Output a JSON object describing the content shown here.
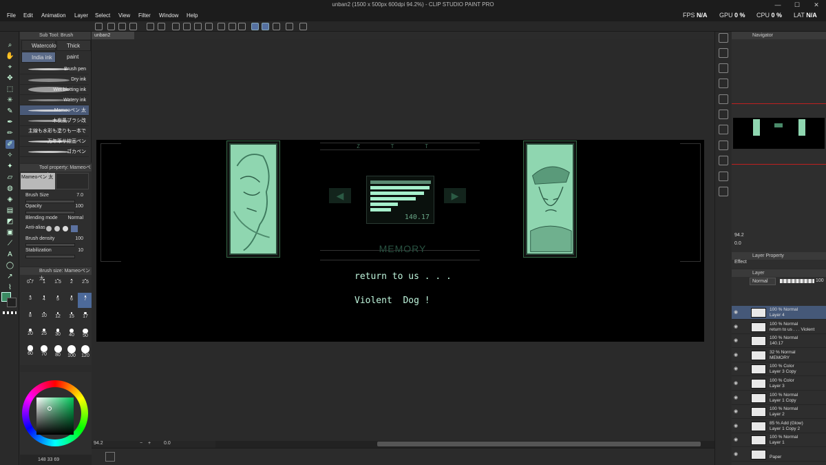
{
  "window": {
    "title": "unban2 (1500 x 500px 600dpi 94.2%) - CLIP STUDIO PAINT PRO",
    "controls": [
      "—",
      "☐",
      "✕"
    ]
  },
  "menu": [
    "File",
    "Edit",
    "Animation",
    "Layer",
    "Select",
    "View",
    "Filter",
    "Window",
    "Help"
  ],
  "perf": {
    "fps_label": "FPS",
    "fps": "N/A",
    "gpu_label": "GPU",
    "gpu": "0 %",
    "cpu_label": "CPU",
    "cpu": "0 %",
    "lat_label": "LAT",
    "lat": "N/A"
  },
  "subtool": {
    "header": "Sub Tool: Brush",
    "tabs": [
      "Watercolor",
      "Thick paint",
      "India ink"
    ],
    "brushes": [
      "Brush pen",
      "Dry ink",
      "Wet blotting ink",
      "Watery ink",
      "Mameoペン 太",
      "木炭風ブラシ改",
      "主線も水彩も塗りも一本で",
      "万年筆サ線画ペン",
      "ゴカペン"
    ]
  },
  "toolprop": {
    "header": "Tool property: Mameoペン 太",
    "preview_name": "Mameoペン 太",
    "brush_size_label": "Brush Size",
    "brush_size": "7.0",
    "opacity_label": "Opacity",
    "opacity": "100",
    "blend_label": "Blending mode",
    "blend": "Normal",
    "antialias_label": "Anti-alias",
    "density_label": "Brush density",
    "density": "100",
    "stabilization_label": "Stabilization",
    "stabilization": "10"
  },
  "brushsize": {
    "header": "Brush size: Mameoペン 太",
    "sizes": [
      "0.7",
      "1",
      "1.5",
      "2",
      "2.5",
      "3",
      "4",
      "5",
      "6",
      "7",
      "8",
      "10",
      "12",
      "15",
      "17",
      "20",
      "25",
      "30",
      "40",
      "50",
      "60",
      "70",
      "80",
      "100",
      "120"
    ]
  },
  "status": {
    "left": "148 33 69"
  },
  "canvas": {
    "tab": "unban2",
    "zoom": "94.2",
    "rotation": "0.0"
  },
  "artwork": {
    "header": "Z T T",
    "meter_value": "140.17",
    "label": "MEMORY",
    "line1": "return to us . . .",
    "line2": "Violent  Dog !"
  },
  "navigator": {
    "header": "Navigator",
    "zoom": "94.2",
    "rotation": "0.0"
  },
  "layerprop": {
    "header": "Layer Property",
    "effect": "Effect"
  },
  "layerpanel": {
    "header": "Layer",
    "blend": "Normal",
    "opacity": "100",
    "layers": [
      {
        "l1": "100 % Normal",
        "l2": "Layer 4"
      },
      {
        "l1": "100 % Normal",
        "l2": "return to us . . . Violent"
      },
      {
        "l1": "100 % Normal",
        "l2": "140.17"
      },
      {
        "l1": "32 % Normal",
        "l2": "MEMORY"
      },
      {
        "l1": "100 % Color",
        "l2": "Layer 3 Copy"
      },
      {
        "l1": "100 % Color",
        "l2": "Layer 3"
      },
      {
        "l1": "100 % Normal",
        "l2": "Layer 1 Copy"
      },
      {
        "l1": "100 % Normal",
        "l2": "Layer 2"
      },
      {
        "l1": "85 % Add (Glow)",
        "l2": "Layer 1 Copy 2"
      },
      {
        "l1": "100 % Normal",
        "l2": "Layer 1"
      },
      {
        "l1": "",
        "l2": "Paper"
      }
    ]
  },
  "colors": {
    "accent": "#4d6a9a",
    "art_green": "#8fd6b0",
    "text_green": "#bff5dc",
    "current_color": "#3a8a62"
  }
}
